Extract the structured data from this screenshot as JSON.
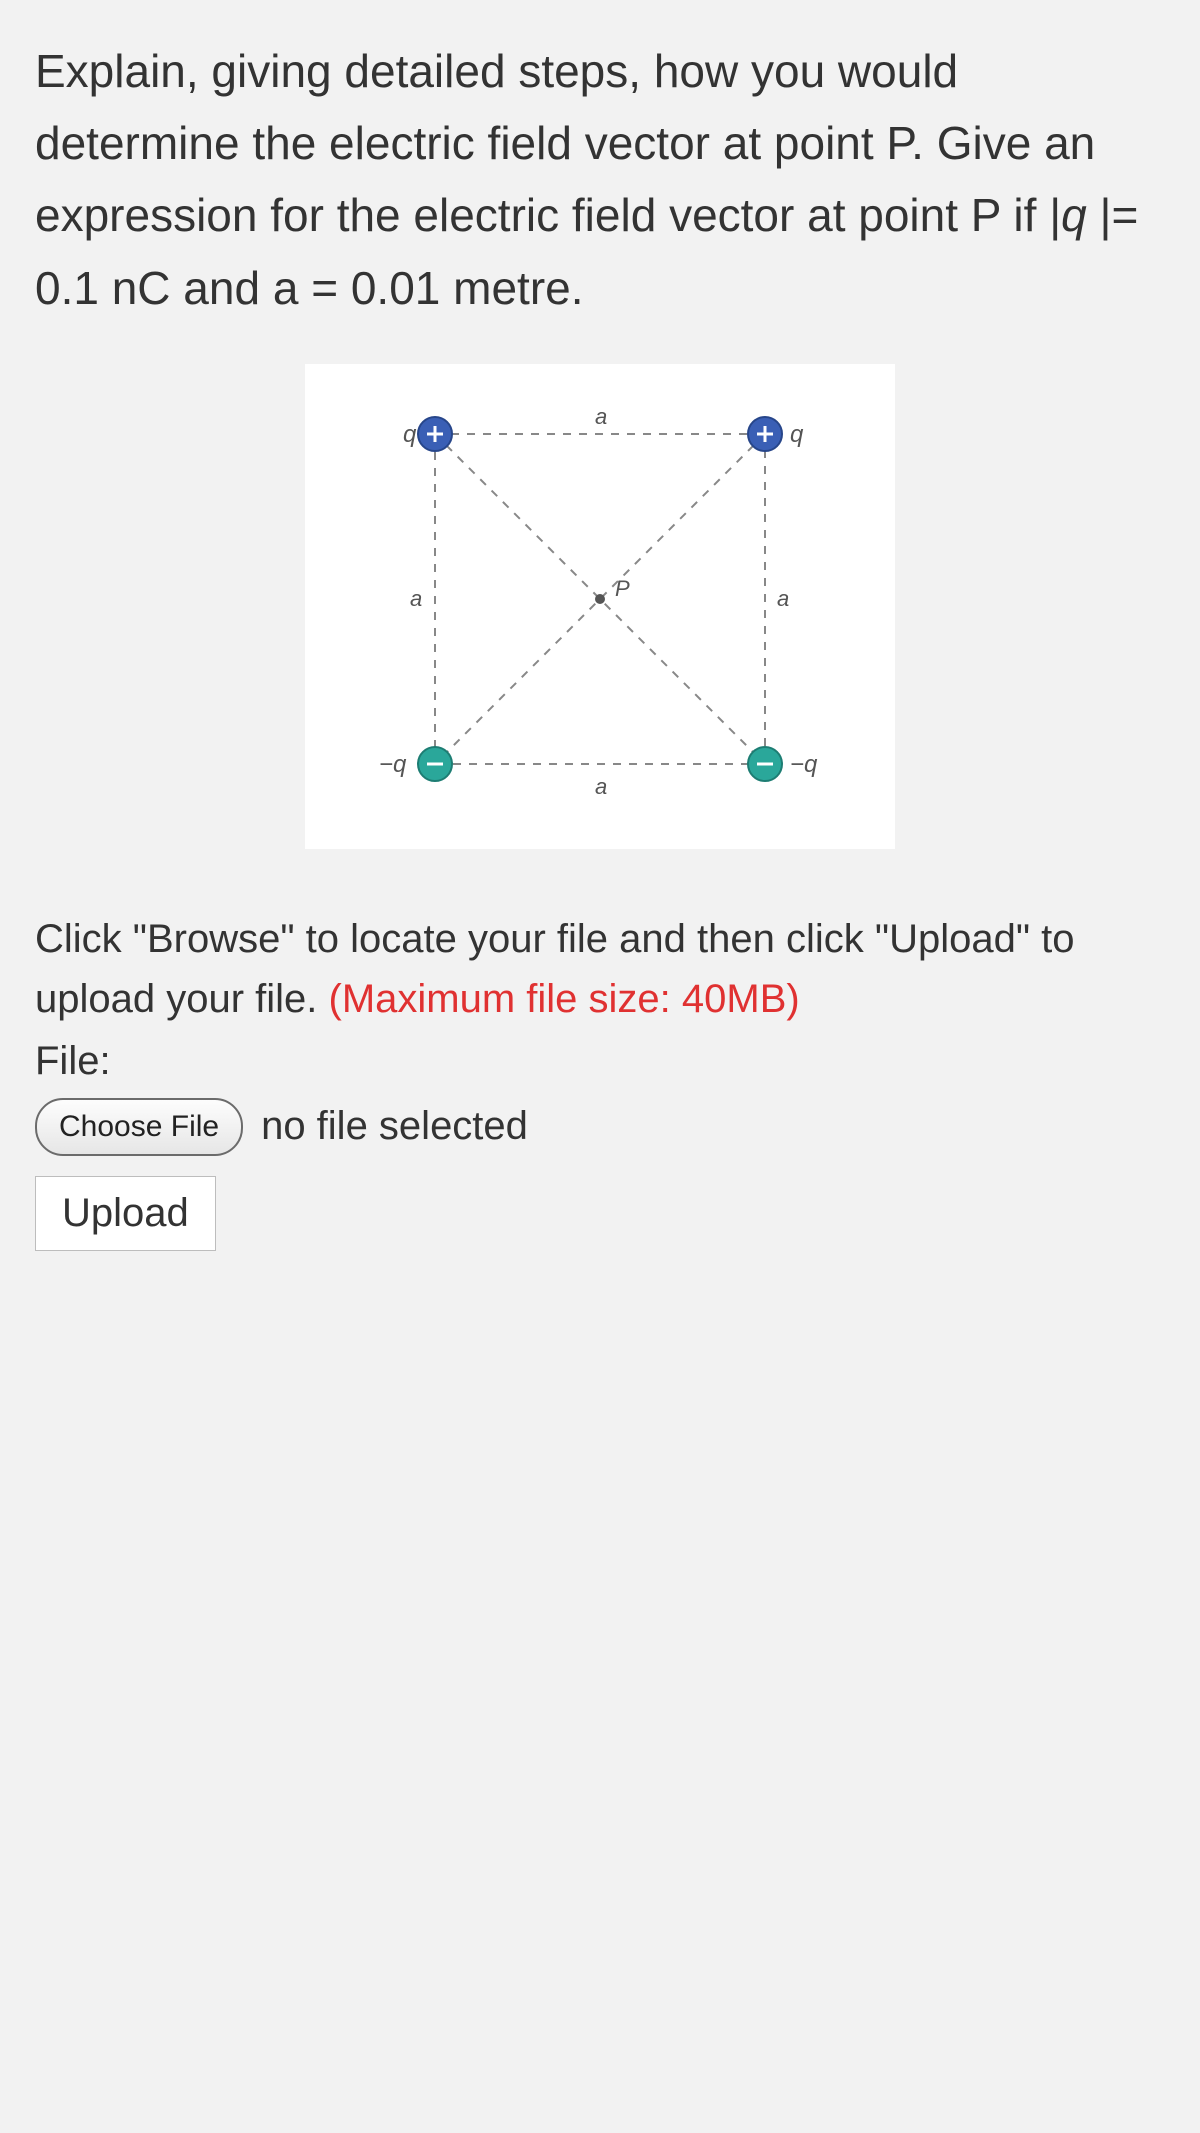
{
  "question": {
    "prefix": "Explain, giving detailed steps, how you would determine the electric field vector at point P. Give an expression for the electric field vector at point P if |",
    "q_var": "q ",
    "after_q": "|= 0.1 nC  and  a = 0.01 metre."
  },
  "diagram": {
    "side_label": "a",
    "center_label": "P",
    "top_left_charge": "q",
    "top_right_charge": "q",
    "bottom_left_charge": "−q",
    "bottom_right_charge": "−q",
    "positive_color": "#3a5fb5",
    "negative_color": "#2aa79a"
  },
  "upload": {
    "instructions_part1": "Click \"Browse\" to locate your file and then click \"Upload\" to upload your file. ",
    "instructions_part2": "(Maximum file size: 40MB)",
    "file_label": "File:",
    "choose_file_label": "Choose File",
    "no_file_text": "no file selected",
    "upload_label": "Upload"
  }
}
